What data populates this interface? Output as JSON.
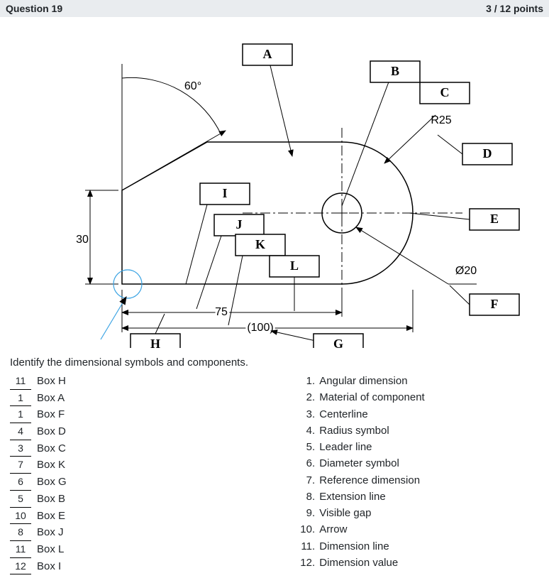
{
  "header": {
    "title": "Question 19",
    "points": "3 / 12 points"
  },
  "figure": {
    "angle": "60°",
    "dim_height": "30",
    "dim_75": "75",
    "dim_100": "(100)",
    "radius": "R25",
    "diameter": "Ø20",
    "boxes": {
      "A": "A",
      "B": "B",
      "C": "C",
      "D": "D",
      "E": "E",
      "F": "F",
      "G": "G",
      "H": "H",
      "I": "I",
      "J": "J",
      "K": "K",
      "L": "L"
    }
  },
  "instruction": "Identify the dimensional symbols and components.",
  "answers": [
    {
      "value": "11",
      "label": "Box H"
    },
    {
      "value": "1",
      "label": "Box A"
    },
    {
      "value": "1",
      "label": "Box F"
    },
    {
      "value": "4",
      "label": "Box D"
    },
    {
      "value": "3",
      "label": "Box C"
    },
    {
      "value": "7",
      "label": "Box K"
    },
    {
      "value": "6",
      "label": "Box G"
    },
    {
      "value": "5",
      "label": "Box B"
    },
    {
      "value": "10",
      "label": "Box E"
    },
    {
      "value": "8",
      "label": "Box J"
    },
    {
      "value": "11",
      "label": "Box L"
    },
    {
      "value": "12",
      "label": "Box I"
    }
  ],
  "key": [
    "Angular dimension",
    "Material of component",
    "Centerline",
    "Radius symbol",
    "Leader line",
    "Diameter symbol",
    "Reference dimension",
    "Extension line",
    "Visible gap",
    "Arrow",
    "Dimension line",
    "Dimension value"
  ]
}
